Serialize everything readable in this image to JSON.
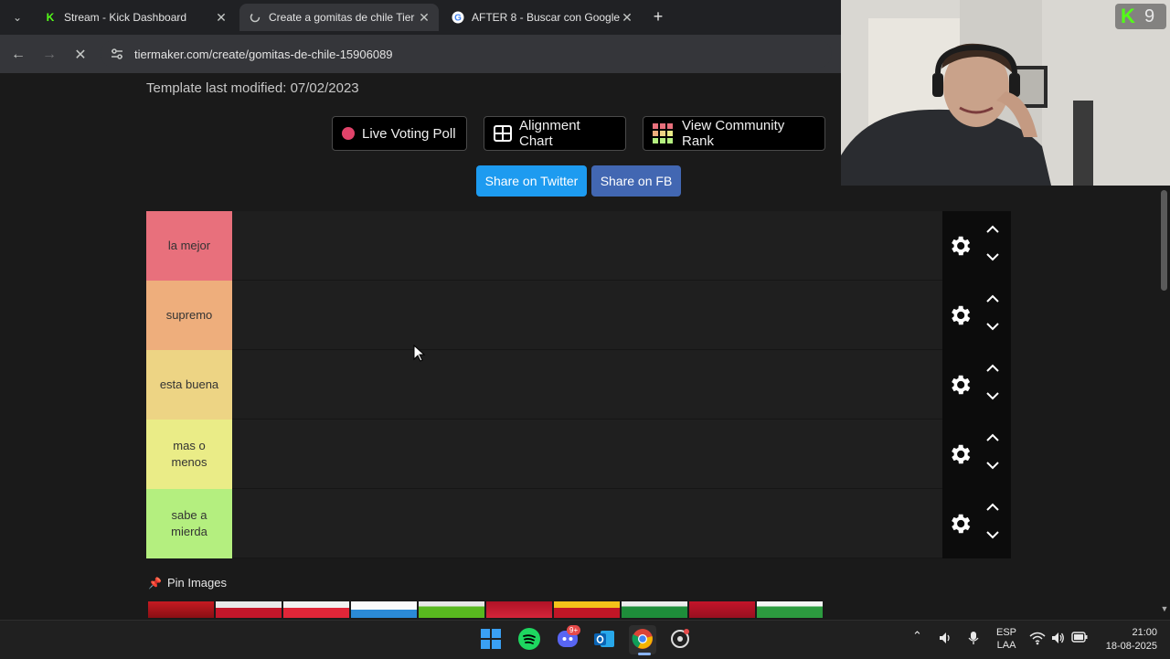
{
  "browser": {
    "tabs": [
      {
        "title": "Stream - Kick Dashboard",
        "active": false
      },
      {
        "title": "Create a gomitas de chile Tier L",
        "active": true
      },
      {
        "title": "AFTER 8 - Buscar con Google",
        "active": false
      }
    ],
    "url": "tiermaker.com/create/gomitas-de-chile-15906089"
  },
  "page": {
    "modified": "Template last modified: 07/02/2023",
    "buttons": {
      "live_voting": "Live Voting Poll",
      "alignment": "Alignment Chart",
      "community": "View Community Rank",
      "twitter": "Share on Twitter",
      "fb": "Share on FB"
    },
    "tiers": [
      {
        "label": "la mejor",
        "color": "#e8707c"
      },
      {
        "label": "supremo",
        "color": "#eeae7c"
      },
      {
        "label": "esta buena",
        "color": "#edd484"
      },
      {
        "label": "mas o menos",
        "color": "#eaec87"
      },
      {
        "label": "sabe a mierda",
        "color": "#b4ef7f"
      }
    ],
    "pin_images": "Pin Images"
  },
  "taskbar": {
    "lang_top": "ESP",
    "lang_bottom": "LAA",
    "time": "21:00",
    "date": "18-08-2025",
    "discord_badge": "9+"
  },
  "overlay": {
    "kick_badge": "9"
  },
  "colors": {
    "twitter": "#1d9bf0",
    "facebook": "#4267b2",
    "kick_green": "#53fc18"
  }
}
